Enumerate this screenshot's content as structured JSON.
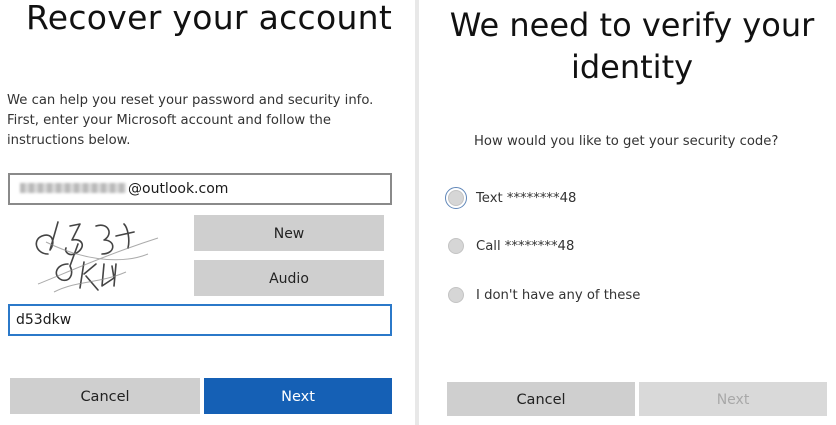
{
  "left": {
    "title": "Recover your account",
    "intro": "We can help you reset your password and security info. First, enter your Microsoft account and follow the instructions below.",
    "email_suffix": "@outlook.com",
    "captcha_value": "d53dkw",
    "new_label": "New",
    "audio_label": "Audio",
    "cancel_label": "Cancel",
    "next_label": "Next"
  },
  "right": {
    "title": "We need to verify your identity",
    "question": "How would you like to get your security code?",
    "options": [
      {
        "label": "Text ********48",
        "focused": true
      },
      {
        "label": "Call ********48",
        "focused": false
      },
      {
        "label": "I don't have any of these",
        "focused": false
      }
    ],
    "cancel_label": "Cancel",
    "next_label": "Next",
    "next_disabled": true
  },
  "colors": {
    "primary": "#1560b5",
    "button_gray": "#cfcfcf",
    "disabled_text": "#a8a8a8",
    "focus_border": "#2b79c9"
  }
}
